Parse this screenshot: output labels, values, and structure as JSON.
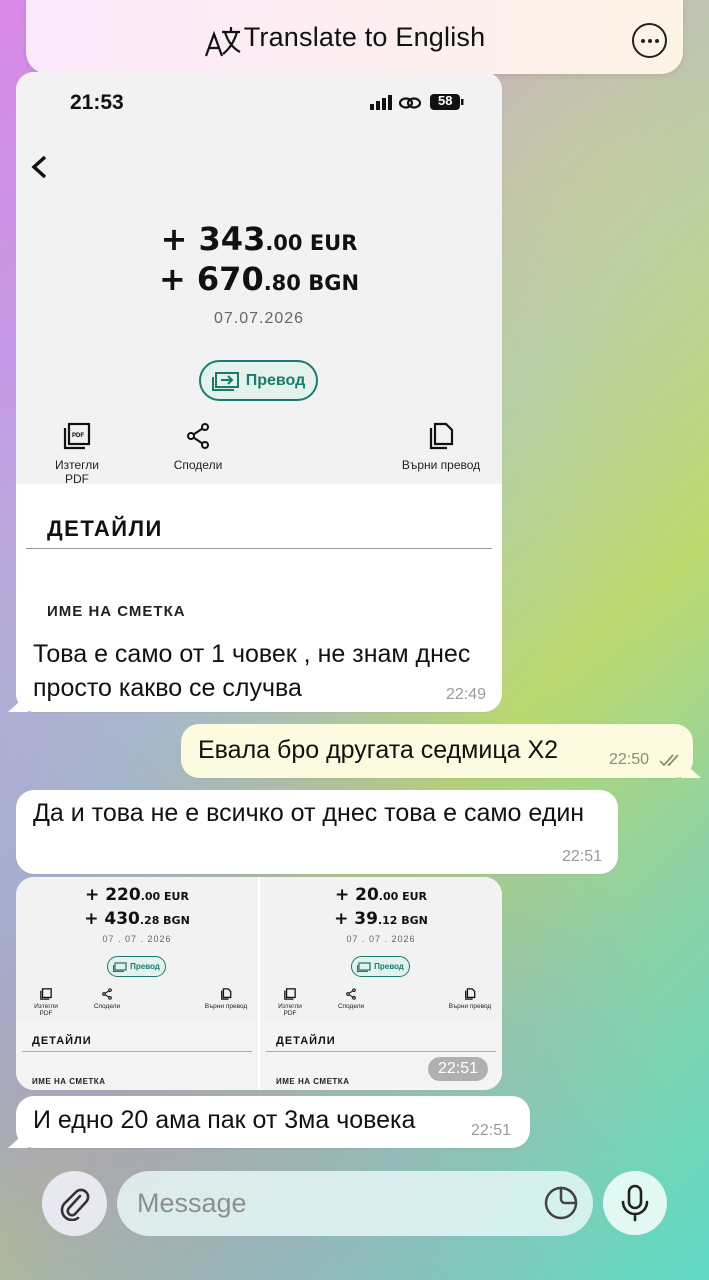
{
  "topbar": {
    "translate_label": "Translate to English"
  },
  "screenshot_main": {
    "status_time": "21:53",
    "battery": "58",
    "amount_eur_int": "+ 343",
    "amount_eur_dec": ".00 EUR",
    "amount_bgn_int": "+ 670",
    "amount_bgn_dec": ".80 BGN",
    "date": "07.07.2026",
    "transfer_label": "Превод",
    "actions": {
      "pdf": "Изтегли PDF",
      "share": "Сподели",
      "return": "Върни превод"
    },
    "details_title": "ДЕТАЙЛИ",
    "account_label": "ИМЕ НА СМЕТКА"
  },
  "messages": [
    {
      "text": "Това е само от 1 човек , не знам днес просто какво се случва",
      "time": "22:49"
    },
    {
      "text": "Евала бро другата седмица Х2",
      "time": "22:50"
    },
    {
      "text": "Да и това не е всичко от днес това е само един",
      "time": "22:51"
    },
    {
      "time": "22:51"
    },
    {
      "text": "И едно 20 ама пак от 3ма човека",
      "time": "22:51"
    }
  ],
  "screenshot_a": {
    "eur_int": "+ 220",
    "eur_dec": ".00 EUR",
    "bgn_int": "+ 430",
    "bgn_dec": ".28 BGN",
    "date": "07 . 07 . 2026",
    "transfer_label": "Превод",
    "pdf": "Изтегли PDF",
    "share": "Сподели",
    "return": "Върни превод",
    "details_title": "ДЕТАЙЛИ",
    "account_label": "ИМЕ НА СМЕТКА"
  },
  "screenshot_b": {
    "eur_int": "+ 20",
    "eur_dec": ".00 EUR",
    "bgn_int": "+ 39",
    "bgn_dec": ".12 BGN",
    "date": "07 . 07 . 2026",
    "transfer_label": "Превод",
    "pdf": "Изтегли PDF",
    "share": "Сподели",
    "return": "Върни превод",
    "details_title": "ДЕТАЙЛИ",
    "account_label": "ИМЕ НА СМЕТКА"
  },
  "composer": {
    "placeholder": "Message"
  },
  "colors": {
    "incoming": "#ffffff",
    "outgoing": "#fcfbe0",
    "accent": "#1b7a6d"
  }
}
